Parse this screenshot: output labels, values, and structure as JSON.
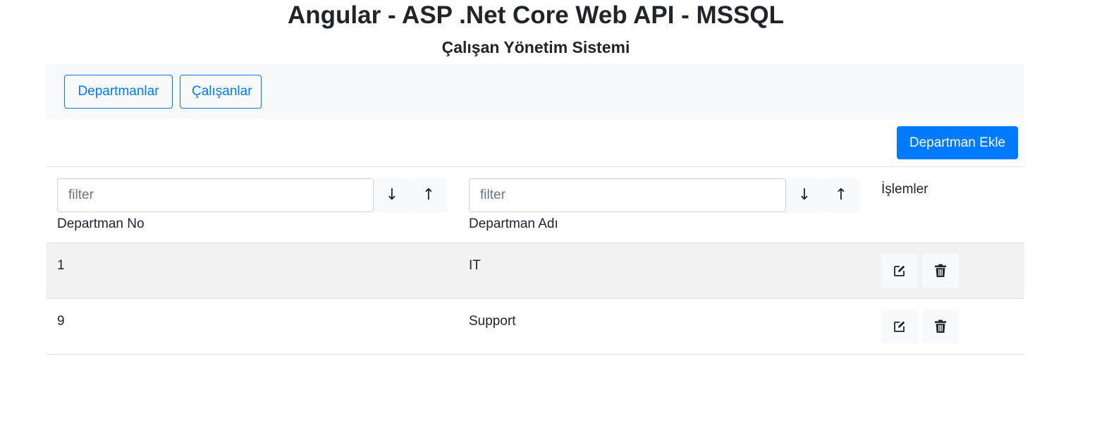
{
  "header": {
    "title": "Angular - ASP .Net Core Web API - MSSQL",
    "subtitle": "Çalışan Yönetim Sistemi"
  },
  "nav": {
    "departments_label": "Departmanlar",
    "employees_label": "Çalışanlar"
  },
  "toolbar": {
    "add_department_label": "Departman Ekle"
  },
  "table": {
    "columns": {
      "dept_no": {
        "label": "Departman No",
        "filter_placeholder": "filter",
        "sort_desc": "↓",
        "sort_asc": "↑"
      },
      "dept_name": {
        "label": "Departman Adı",
        "filter_placeholder": "filter",
        "sort_desc": "↓",
        "sort_asc": "↑"
      },
      "actions": {
        "label": "İşlemler"
      }
    },
    "rows": [
      {
        "id": "1",
        "name": "IT"
      },
      {
        "id": "9",
        "name": "Support"
      }
    ]
  },
  "icons": {
    "edit": "edit-icon",
    "delete": "trash-icon"
  },
  "colors": {
    "primary": "#007bff",
    "light": "#f8f9fa",
    "stripe": "#f2f2f2"
  }
}
